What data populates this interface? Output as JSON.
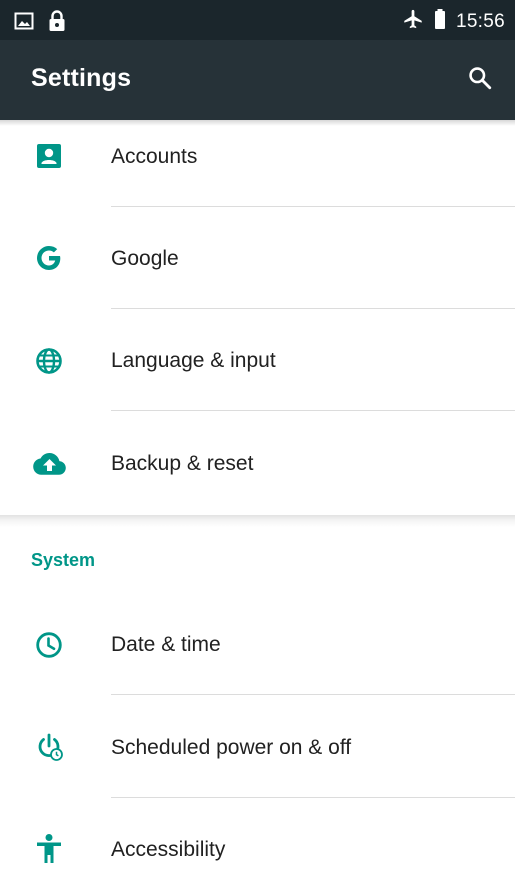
{
  "status_bar": {
    "time": "15:56",
    "left_icons": [
      "image-notification-icon",
      "lock-icon"
    ],
    "right_icons": [
      "airplane-mode-icon",
      "battery-icon"
    ]
  },
  "app_bar": {
    "title": "Settings",
    "search_icon": "search-icon"
  },
  "accent_color": "#009688",
  "top_items": [
    {
      "label": "Accounts",
      "icon": "account-icon"
    },
    {
      "label": "Google",
      "icon": "google-icon"
    },
    {
      "label": "Language & input",
      "icon": "globe-icon"
    },
    {
      "label": "Backup & reset",
      "icon": "cloud-upload-icon"
    }
  ],
  "system_section": {
    "header": "System",
    "items": [
      {
        "label": "Date & time",
        "icon": "clock-icon"
      },
      {
        "label": "Scheduled power on & off",
        "icon": "scheduled-power-icon"
      },
      {
        "label": "Accessibility",
        "icon": "accessibility-icon"
      }
    ]
  }
}
